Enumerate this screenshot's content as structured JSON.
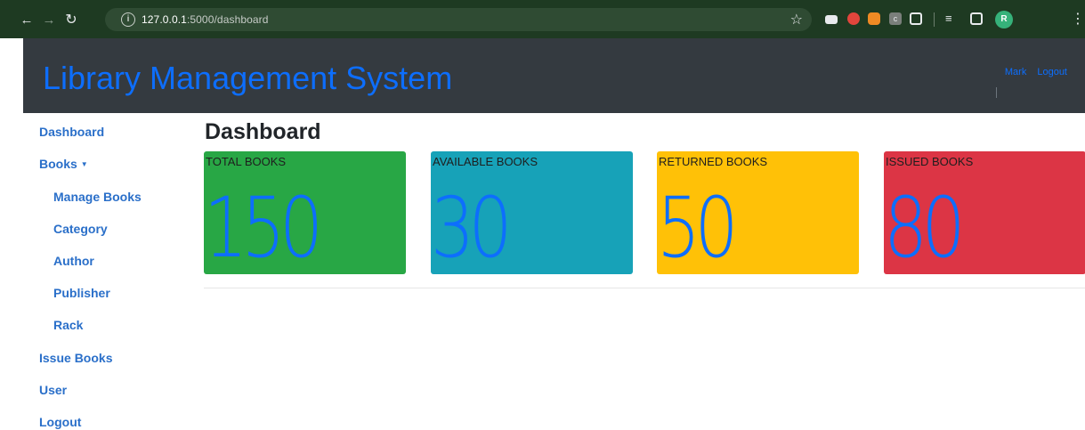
{
  "browser": {
    "url_host": "127.0.0.1",
    "url_rest": ":5000/dashboard",
    "profile_initial": "R",
    "ext_label": "c"
  },
  "app": {
    "title": "Library Management System",
    "user_link": "Mark",
    "logout_link": "Logout"
  },
  "sidebar": {
    "items": [
      {
        "label": "Dashboard"
      },
      {
        "label": "Books"
      },
      {
        "label": "Manage Books"
      },
      {
        "label": "Category"
      },
      {
        "label": "Author"
      },
      {
        "label": "Publisher"
      },
      {
        "label": "Rack"
      },
      {
        "label": "Issue Books"
      },
      {
        "label": "User"
      },
      {
        "label": "Logout"
      }
    ]
  },
  "main": {
    "title": "Dashboard",
    "cards": [
      {
        "label": "TOTAL BOOKS",
        "value": "150",
        "color": "#28a745"
      },
      {
        "label": "AVAILABLE BOOKS",
        "value": "30",
        "color": "#17a2b8"
      },
      {
        "label": "RETURNED BOOKS",
        "value": "50",
        "color": "#ffc107"
      },
      {
        "label": "ISSUED BOOKS",
        "value": "80",
        "color": "#dc3545"
      }
    ]
  },
  "colors": {
    "accent": "#0d6efd",
    "header_bg": "#343a40",
    "sidebar_link": "#2a6fc9"
  }
}
